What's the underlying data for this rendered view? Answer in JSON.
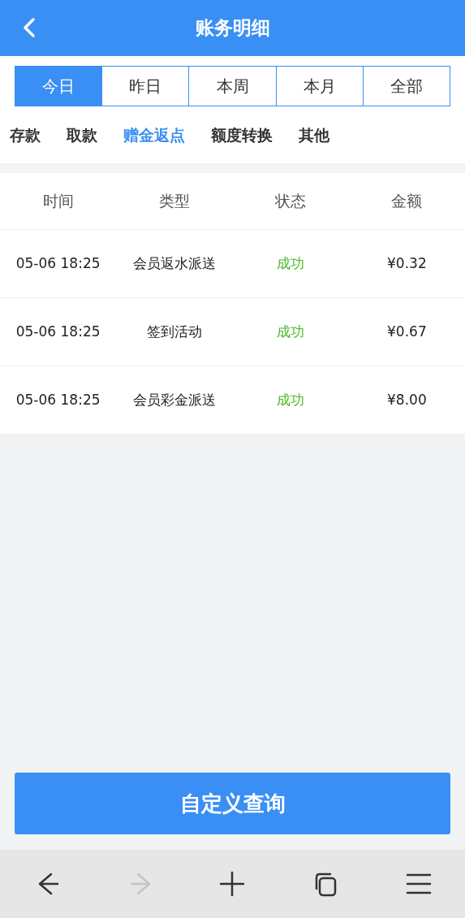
{
  "header": {
    "title": "账务明细"
  },
  "period_tabs": [
    {
      "label": "今日",
      "selected": true
    },
    {
      "label": "昨日",
      "selected": false
    },
    {
      "label": "本周",
      "selected": false
    },
    {
      "label": "本月",
      "selected": false
    },
    {
      "label": "全部",
      "selected": false
    }
  ],
  "category_tabs": [
    {
      "label": "存款",
      "selected": false
    },
    {
      "label": "取款",
      "selected": false
    },
    {
      "label": "赠金返点",
      "selected": true
    },
    {
      "label": "额度转换",
      "selected": false
    },
    {
      "label": "其他",
      "selected": false
    }
  ],
  "table": {
    "columns": [
      "时间",
      "类型",
      "状态",
      "金额"
    ],
    "rows": [
      {
        "cells": [
          "05-06 18:25",
          "会员返水派送",
          "成功",
          "¥0.32"
        ]
      },
      {
        "cells": [
          "05-06 18:25",
          "签到活动",
          "成功",
          "¥0.67"
        ]
      },
      {
        "cells": [
          "05-06 18:25",
          "会员彩金派送",
          "成功",
          "¥8.00"
        ]
      }
    ]
  },
  "query_button": {
    "label": "自定义查询"
  },
  "browser_bar": [
    {
      "kind": "back",
      "disabled": false
    },
    {
      "kind": "forward",
      "disabled": true
    },
    {
      "kind": "add",
      "disabled": false
    },
    {
      "kind": "tabs",
      "disabled": false
    },
    {
      "kind": "menu",
      "disabled": false
    }
  ]
}
